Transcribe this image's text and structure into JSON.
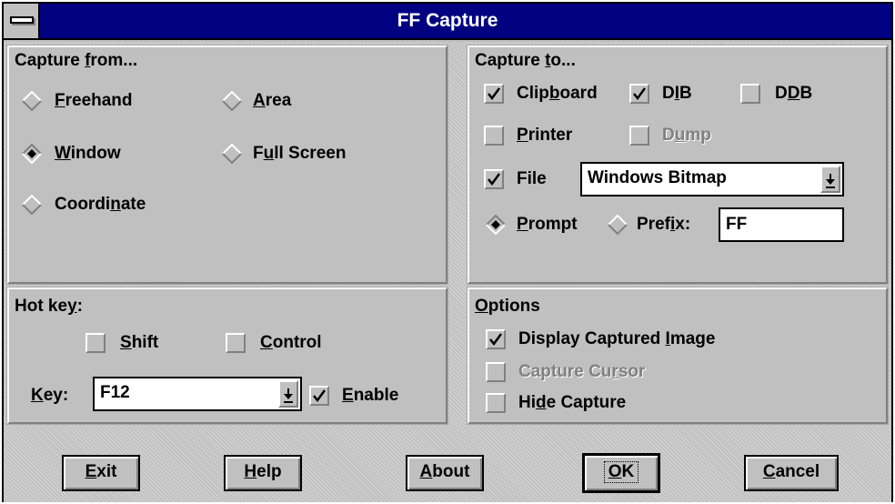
{
  "window": {
    "title": "FF Capture"
  },
  "capture_from": {
    "title": "Capture from...",
    "options": {
      "freehand": {
        "label": "Freehand",
        "selected": false
      },
      "area": {
        "label": "Area",
        "selected": false
      },
      "window": {
        "label": "Window",
        "selected": true
      },
      "full_screen": {
        "label": "Full Screen",
        "selected": false
      },
      "coordinate": {
        "label": "Coordinate",
        "selected": false
      }
    }
  },
  "capture_to": {
    "title": "Capture to...",
    "clipboard": {
      "label": "Clipboard",
      "checked": true
    },
    "dib": {
      "label": "DIB",
      "checked": true
    },
    "ddb": {
      "label": "DDB",
      "checked": false
    },
    "printer": {
      "label": "Printer",
      "checked": false
    },
    "dump": {
      "label": "Dump",
      "checked": false,
      "enabled": false
    },
    "file": {
      "label": "File",
      "checked": true
    },
    "file_format": {
      "value": "Windows Bitmap"
    },
    "prompt": {
      "label": "Prompt",
      "selected": true
    },
    "prefix": {
      "label": "Prefix:",
      "selected": false,
      "value": "FF"
    }
  },
  "hot_key": {
    "title": "Hot key:",
    "shift": {
      "label": "Shift",
      "checked": false
    },
    "control": {
      "label": "Control",
      "checked": false
    },
    "key_label": "Key:",
    "key_value": "F12",
    "enable": {
      "label": "Enable",
      "checked": true
    }
  },
  "options": {
    "title": "Options",
    "display_captured_image": {
      "label": "Display Captured Image",
      "checked": true
    },
    "capture_cursor": {
      "label": "Capture Cursor",
      "checked": false,
      "enabled": false
    },
    "hide_capture": {
      "label": "Hide Capture",
      "checked": false
    }
  },
  "buttons": {
    "exit": "Exit",
    "help": "Help",
    "about": "About",
    "ok": "OK",
    "cancel": "Cancel"
  }
}
